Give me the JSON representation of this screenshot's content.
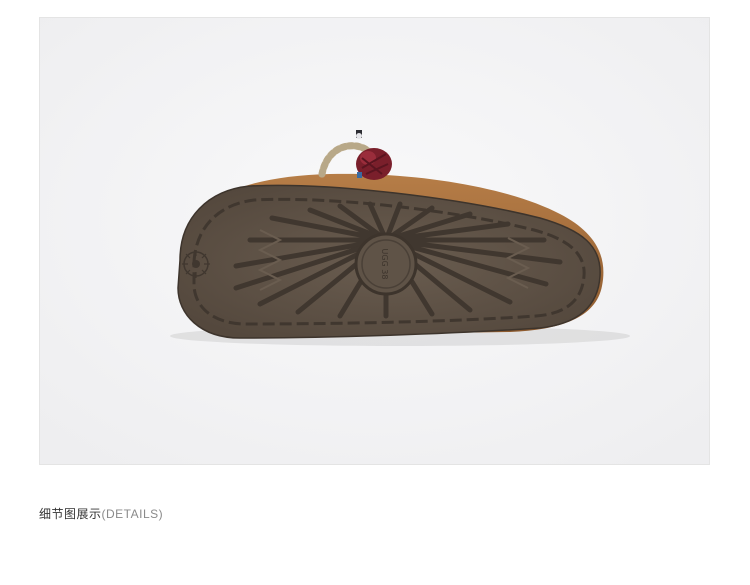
{
  "caption": {
    "main": "细节图展示",
    "sub": "(DETAILS)"
  },
  "image": {
    "subject": "slipper-sole",
    "colors": {
      "background": "#f6f6f7",
      "upper_suede": "#a8703e",
      "sole_rubber": "#5f5347",
      "sole_tread": "#4a4037",
      "knot_red": "#7a1f2b",
      "rope": "#d8cbb4"
    }
  }
}
